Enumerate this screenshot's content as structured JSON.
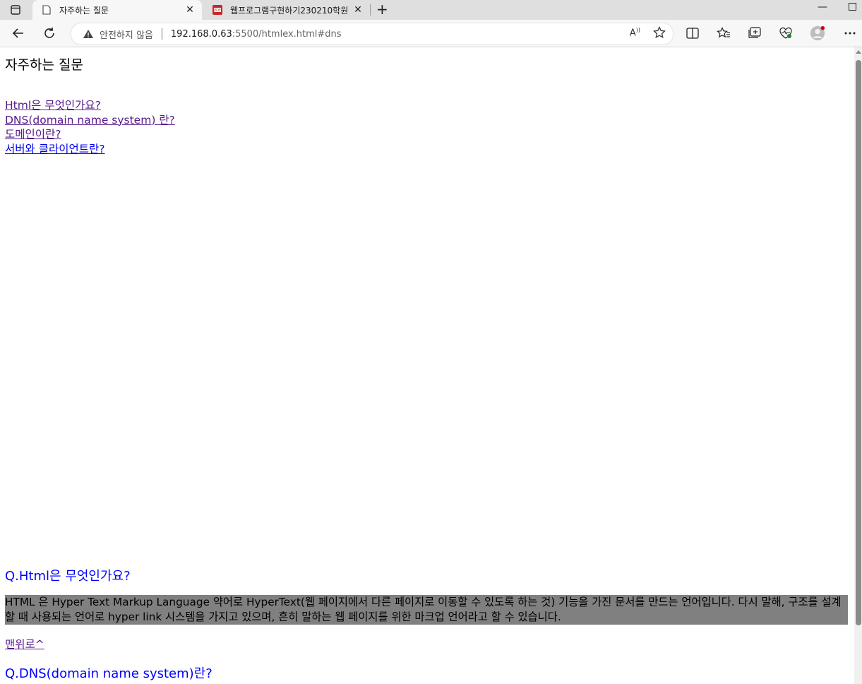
{
  "browser": {
    "tabs": [
      {
        "title": "자주하는 질문",
        "active": true,
        "icon": "page-icon"
      },
      {
        "title": "웹프로그램구현하기230210학원",
        "active": false,
        "icon": "pdf-icon"
      }
    ],
    "new_tab": "+",
    "security_label": "안전하지 않음",
    "url_host": "192.168.0.63",
    "url_rest": ":5500/htmlex.html#dns"
  },
  "page": {
    "title": "자주하는 질문",
    "toc": [
      {
        "label": "Html은 무엇인가요?"
      },
      {
        "label": "DNS(domain name system) 란?"
      },
      {
        "label": "도메인이란?"
      },
      {
        "label": "서버와 클라이언트란?"
      }
    ],
    "q1_heading": "Q.Html은 무엇인가요?",
    "q1_answer": "HTML 은 Hyper Text Markup Language 약어로 HyperText(웹 페이지에서 다른 페이지로 이동할 수 있도록 하는 것) 기능을 가진 문서를 만드는 언어입니다. 다시 말해, 구조를 설계할 때 사용되는 언어로 hyper link 시스템을 가지고 있으며, 흔히 말하는 웹 페이지를 위한 마크업 언어라고 할 수 있습니다.",
    "back_to_top": "맨위로^",
    "q2_heading": "Q.DNS(domain name system)란?"
  },
  "colors": {
    "link_visited": "#551a8b",
    "link_unvisited": "#0000ee",
    "heading": "#0000ff",
    "answer_bg": "#808080"
  }
}
